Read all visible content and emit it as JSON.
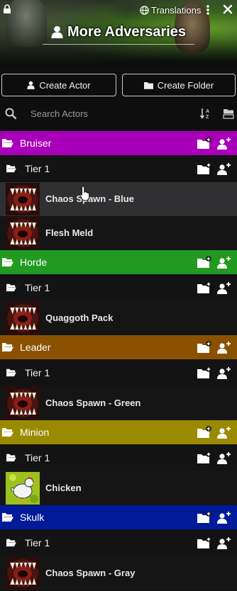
{
  "header": {
    "translations_label": "Translations",
    "title": "More Adversaries"
  },
  "actions": {
    "create_actor": "Create Actor",
    "create_folder": "Create Folder"
  },
  "search": {
    "placeholder": "Search Actors"
  },
  "folders": [
    {
      "name": "Bruiser",
      "color": "#a800b8",
      "subfolders": [
        {
          "name": "Tier 1",
          "entries": [
            "Chaos Spawn - Blue",
            "Flesh Meld"
          ]
        }
      ]
    },
    {
      "name": "Horde",
      "color": "#229a22",
      "subfolders": [
        {
          "name": "Tier 1",
          "entries": [
            "Quaggoth Pack"
          ]
        }
      ]
    },
    {
      "name": "Leader",
      "color": "#8a5200",
      "subfolders": [
        {
          "name": "Tier 1",
          "entries": [
            "Chaos Spawn - Green"
          ]
        }
      ]
    },
    {
      "name": "Minion",
      "color": "#9a8a00",
      "subfolders": [
        {
          "name": "Tier 1",
          "entries": [
            "Chicken"
          ]
        }
      ]
    },
    {
      "name": "Skulk",
      "color": "#001a9a",
      "subfolders": [
        {
          "name": "Tier 1",
          "entries": [
            "Chaos Spawn - Gray"
          ]
        }
      ]
    }
  ],
  "icons": {
    "lock": "lock-icon",
    "globe": "globe-icon",
    "menu": "kebab-menu-icon",
    "close": "close-icon",
    "user": "user-icon",
    "folder": "folder-icon",
    "search": "search-icon",
    "sort": "sort-icon",
    "collapse": "collapse-all-icon"
  }
}
